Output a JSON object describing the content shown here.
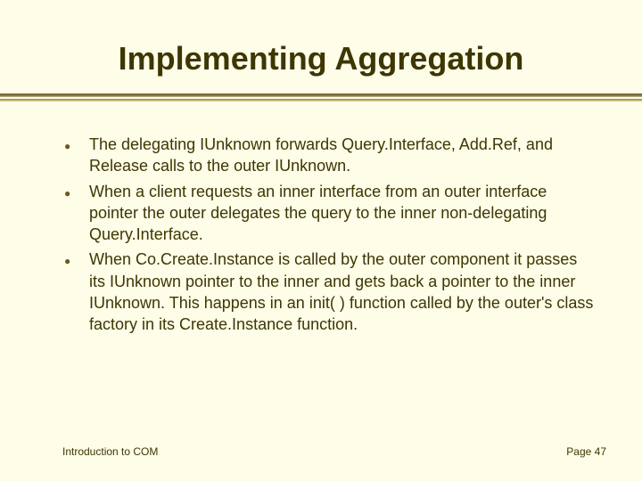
{
  "title": "Implementing Aggregation",
  "bullets": [
    "The delegating IUnknown  forwards Query.Interface, Add.Ref, and Release calls to the outer IUnknown.",
    "When a client requests an inner interface from an outer interface pointer the outer delegates the query to the inner non-delegating Query.Interface.",
    "When Co.Create.Instance is called by the outer component it passes its IUnknown pointer to the inner and gets back a pointer to the inner IUnknown.  This happens in an init( ) function called by the outer's class factory in its Create.Instance function."
  ],
  "footer": {
    "left": "Introduction to COM",
    "right": "Page 47"
  }
}
